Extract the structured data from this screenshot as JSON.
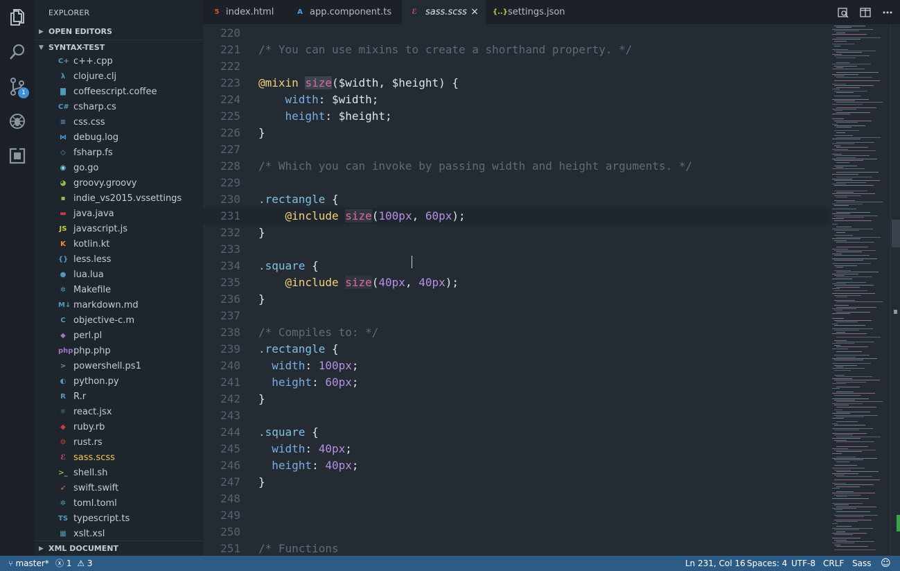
{
  "sidebar": {
    "title": "EXPLORER",
    "open_editors": "OPEN EDITORS",
    "project": "SYNTAX-TEST",
    "xml_document": "XML DOCUMENT",
    "files": [
      {
        "name": "c++.cpp",
        "icon": "cpp-icon",
        "glyph": "C+",
        "color": "#519aba"
      },
      {
        "name": "clojure.clj",
        "icon": "lambda-icon",
        "glyph": "λ",
        "color": "#519aba"
      },
      {
        "name": "coffeescript.coffee",
        "icon": "coffee-icon",
        "glyph": "▇",
        "color": "#519aba"
      },
      {
        "name": "csharp.cs",
        "icon": "csharp-icon",
        "glyph": "C#",
        "color": "#519aba"
      },
      {
        "name": "css.css",
        "icon": "css-icon",
        "glyph": "≡",
        "color": "#519aba"
      },
      {
        "name": "debug.log",
        "icon": "vscode-icon",
        "glyph": "⋈",
        "color": "#4a9ee6"
      },
      {
        "name": "fsharp.fs",
        "icon": "fsharp-icon",
        "glyph": "◇",
        "color": "#519aba"
      },
      {
        "name": "go.go",
        "icon": "gopher-icon",
        "glyph": "◉",
        "color": "#7fd5ea"
      },
      {
        "name": "groovy.groovy",
        "icon": "groovy-icon",
        "glyph": "◕",
        "color": "#8dc149"
      },
      {
        "name": "indie_vs2015.vssettings",
        "icon": "file-icon",
        "glyph": "▪",
        "color": "#8dc149"
      },
      {
        "name": "java.java",
        "icon": "java-icon",
        "glyph": "▬",
        "color": "#cc3e44"
      },
      {
        "name": "javascript.js",
        "icon": "js-icon",
        "glyph": "JS",
        "color": "#cbcb41"
      },
      {
        "name": "kotlin.kt",
        "icon": "kotlin-icon",
        "glyph": "K",
        "color": "#f88a3c"
      },
      {
        "name": "less.less",
        "icon": "braces-icon",
        "glyph": "{}",
        "color": "#519aba"
      },
      {
        "name": "lua.lua",
        "icon": "lua-icon",
        "glyph": "●",
        "color": "#519aba"
      },
      {
        "name": "Makefile",
        "icon": "gear-icon",
        "glyph": "✲",
        "color": "#519aba"
      },
      {
        "name": "markdown.md",
        "icon": "markdown-icon",
        "glyph": "M↓",
        "color": "#519aba"
      },
      {
        "name": "objective-c.m",
        "icon": "objc-icon",
        "glyph": "C",
        "color": "#519aba"
      },
      {
        "name": "perl.pl",
        "icon": "perl-icon",
        "glyph": "◆",
        "color": "#a074c4"
      },
      {
        "name": "php.php",
        "icon": "php-icon",
        "glyph": "php",
        "color": "#a074c4"
      },
      {
        "name": "powershell.ps1",
        "icon": "powershell-icon",
        "glyph": ">",
        "color": "#519aba"
      },
      {
        "name": "python.py",
        "icon": "python-icon",
        "glyph": "◐",
        "color": "#519aba"
      },
      {
        "name": "R.r",
        "icon": "r-icon",
        "glyph": "R",
        "color": "#519aba"
      },
      {
        "name": "react.jsx",
        "icon": "react-icon",
        "glyph": "⚛",
        "color": "#519aba"
      },
      {
        "name": "ruby.rb",
        "icon": "ruby-icon",
        "glyph": "◆",
        "color": "#cc3e44"
      },
      {
        "name": "rust.rs",
        "icon": "rust-icon",
        "glyph": "⚙",
        "color": "#cc3e44"
      },
      {
        "name": "sass.scss",
        "icon": "sass-icon",
        "glyph": "ℰ",
        "color": "#f55385",
        "active": true
      },
      {
        "name": "shell.sh",
        "icon": "terminal-icon",
        "glyph": ">_",
        "color": "#8dc149"
      },
      {
        "name": "swift.swift",
        "icon": "swift-icon",
        "glyph": "➶",
        "color": "#e37933"
      },
      {
        "name": "toml.toml",
        "icon": "gear-icon",
        "glyph": "✲",
        "color": "#519aba"
      },
      {
        "name": "typescript.ts",
        "icon": "ts-icon",
        "glyph": "TS",
        "color": "#519aba"
      },
      {
        "name": "xslt.xsl",
        "icon": "xml-icon",
        "glyph": "▦",
        "color": "#519aba"
      }
    ]
  },
  "tabs": [
    {
      "label": "index.html",
      "icon": "html5-icon",
      "glyph": "5",
      "color": "#e34c26"
    },
    {
      "label": "app.component.ts",
      "icon": "angular-icon",
      "glyph": "A",
      "color": "#4a9ee6"
    },
    {
      "label": "sass.scss",
      "icon": "sass-icon",
      "glyph": "ℰ",
      "color": "#f55385",
      "active": true,
      "close": "×"
    },
    {
      "label": "settings.json",
      "icon": "json-icon",
      "glyph": "{..}",
      "color": "#cbcb41"
    }
  ],
  "activity_badge": "1",
  "editor": {
    "lines": [
      {
        "n": "220",
        "t": []
      },
      {
        "n": "221",
        "t": [
          [
            "c-cmt",
            "/* You can use mixins to create a shorthand property. */"
          ]
        ]
      },
      {
        "n": "222",
        "t": []
      },
      {
        "n": "223",
        "t": [
          [
            "c-at",
            "@mixin"
          ],
          [
            "",
            " "
          ],
          [
            "c-fn hl",
            "size"
          ],
          [
            "c-pn",
            "("
          ],
          [
            "c-var",
            "$width"
          ],
          [
            "c-pn",
            ", "
          ],
          [
            "c-var",
            "$height"
          ],
          [
            "c-pn",
            ") {"
          ]
        ]
      },
      {
        "n": "224",
        "t": [
          [
            "",
            "    "
          ],
          [
            "c-prop",
            "width"
          ],
          [
            "c-pn",
            ": "
          ],
          [
            "c-var",
            "$width"
          ],
          [
            "c-pn",
            ";"
          ]
        ]
      },
      {
        "n": "225",
        "t": [
          [
            "",
            "    "
          ],
          [
            "c-prop",
            "height"
          ],
          [
            "c-pn",
            ": "
          ],
          [
            "c-var",
            "$height"
          ],
          [
            "c-pn",
            ";"
          ]
        ]
      },
      {
        "n": "226",
        "t": [
          [
            "c-pn",
            "}"
          ]
        ]
      },
      {
        "n": "227",
        "t": []
      },
      {
        "n": "228",
        "t": [
          [
            "c-cmt",
            "/* Which you can invoke by passing width and height arguments. */"
          ]
        ]
      },
      {
        "n": "229",
        "t": []
      },
      {
        "n": "230",
        "t": [
          [
            "c-sel",
            ".rectangle"
          ],
          [
            "c-pn",
            " {"
          ]
        ]
      },
      {
        "n": "231",
        "cur": true,
        "t": [
          [
            "",
            "    "
          ],
          [
            "c-at",
            "@include"
          ],
          [
            "",
            " "
          ],
          [
            "c-fn hl2",
            "size"
          ],
          [
            "c-pn",
            "("
          ],
          [
            "c-num",
            "100px"
          ],
          [
            "c-pn",
            ", "
          ],
          [
            "c-num",
            "60px"
          ],
          [
            "c-pn",
            ");"
          ]
        ]
      },
      {
        "n": "232",
        "t": [
          [
            "c-pn",
            "}"
          ]
        ]
      },
      {
        "n": "233",
        "t": []
      },
      {
        "n": "234",
        "t": [
          [
            "c-sel",
            ".square"
          ],
          [
            "c-pn",
            " {"
          ]
        ]
      },
      {
        "n": "235",
        "t": [
          [
            "",
            "    "
          ],
          [
            "c-at",
            "@include"
          ],
          [
            "",
            " "
          ],
          [
            "c-fn hl2",
            "size"
          ],
          [
            "c-pn",
            "("
          ],
          [
            "c-num",
            "40px"
          ],
          [
            "c-pn",
            ", "
          ],
          [
            "c-num",
            "40px"
          ],
          [
            "c-pn",
            ");"
          ]
        ]
      },
      {
        "n": "236",
        "t": [
          [
            "c-pn",
            "}"
          ]
        ]
      },
      {
        "n": "237",
        "t": []
      },
      {
        "n": "238",
        "t": [
          [
            "c-cmt",
            "/* Compiles to: */"
          ]
        ]
      },
      {
        "n": "239",
        "t": [
          [
            "c-sel",
            ".rectangle"
          ],
          [
            "c-pn",
            " {"
          ]
        ]
      },
      {
        "n": "240",
        "t": [
          [
            "",
            "  "
          ],
          [
            "c-prop",
            "width"
          ],
          [
            "c-pn",
            ": "
          ],
          [
            "c-num",
            "100px"
          ],
          [
            "c-pn",
            ";"
          ]
        ]
      },
      {
        "n": "241",
        "t": [
          [
            "",
            "  "
          ],
          [
            "c-prop",
            "height"
          ],
          [
            "c-pn",
            ": "
          ],
          [
            "c-num",
            "60px"
          ],
          [
            "c-pn",
            ";"
          ]
        ]
      },
      {
        "n": "242",
        "t": [
          [
            "c-pn",
            "}"
          ]
        ]
      },
      {
        "n": "243",
        "t": []
      },
      {
        "n": "244",
        "t": [
          [
            "c-sel",
            ".square"
          ],
          [
            "c-pn",
            " {"
          ]
        ]
      },
      {
        "n": "245",
        "t": [
          [
            "",
            "  "
          ],
          [
            "c-prop",
            "width"
          ],
          [
            "c-pn",
            ": "
          ],
          [
            "c-num",
            "40px"
          ],
          [
            "c-pn",
            ";"
          ]
        ]
      },
      {
        "n": "246",
        "t": [
          [
            "",
            "  "
          ],
          [
            "c-prop",
            "height"
          ],
          [
            "c-pn",
            ": "
          ],
          [
            "c-num",
            "40px"
          ],
          [
            "c-pn",
            ";"
          ]
        ]
      },
      {
        "n": "247",
        "t": [
          [
            "c-pn",
            "}"
          ]
        ]
      },
      {
        "n": "248",
        "t": []
      },
      {
        "n": "249",
        "t": []
      },
      {
        "n": "250",
        "t": []
      },
      {
        "n": "251",
        "t": [
          [
            "c-cmt",
            "/* Functions"
          ]
        ]
      }
    ]
  },
  "status": {
    "branch": "master*",
    "errors": "1",
    "warnings": "3",
    "position": "Ln 231, Col 16",
    "spaces": "Spaces: 4",
    "encoding": "UTF-8",
    "eol": "CRLF",
    "language": "Sass"
  },
  "colors": {
    "accent": "#2c5c86",
    "badge": "#3f8fd2",
    "active_file": "#f1c85f"
  }
}
